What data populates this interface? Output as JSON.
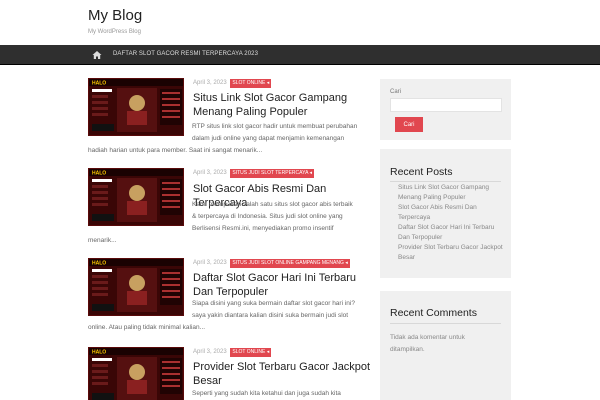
{
  "site": {
    "title": "My Blog",
    "description": "My WordPress Blog"
  },
  "nav": {
    "home_icon": "home-icon",
    "link": "DAFTAR SLOT GACOR RESMI TERPERCAYA 2023"
  },
  "thumbnail_logo": "HALO",
  "posts": [
    {
      "date": "April 3, 2023",
      "category": "SLOT ONLINE",
      "title": "Situs Link Slot Gacor Gampang Menang Paling Populer",
      "excerpt_1": "RTP situs link slot gacor hadir untuk membuat perubahan",
      "excerpt_2": "dalam judi online yang dapat menjamin kemenangan",
      "excerpt_3": "hadiah harian untuk para member. Saat ini sangat menarik..."
    },
    {
      "date": "April 3, 2023",
      "category": "SITUS JUDI SLOT TERPERCAYA",
      "title": "Slot Gacor Abis Resmi Dan Terpercaya",
      "excerpt_1": "Kami  merupakan salah satu situs slot gacor abis terbaik",
      "excerpt_2": "& terpercaya di Indonesia. Situs judi slot online yang",
      "excerpt_3": "Berlisensi Resmi.ini, menyediakan promo insentif",
      "excerpt_4": "menarik..."
    },
    {
      "date": "April 3, 2023",
      "category": "SITUS JUDI SLOT ONLINE GAMPANG MENANG",
      "title": "Daftar Slot Gacor Hari Ini Terbaru Dan Terpopuler",
      "excerpt_1": "Siapa disini yang suka bermain daftar slot gacor hari ini?",
      "excerpt_2": "saya yakin diantara kalian disini suka bermain judi slot",
      "excerpt_3": "online. Atau paling tidak minimal kalian..."
    },
    {
      "date": "April 3, 2023",
      "category": "SLOT ONLINE",
      "title": "Provider Slot Terbaru Gacor Jackpot Besar",
      "excerpt_1": "Seperti yang sudah kita ketahui dan juga sudah kita"
    }
  ],
  "sidebar": {
    "search": {
      "label": "Cari",
      "value": "",
      "button": "Cari"
    },
    "recent_posts": {
      "title": "Recent Posts",
      "items": [
        "Situs Link Slot Gacor Gampang Menang Paling Populer",
        "Slot Gacor Abis Resmi Dan Terpercaya",
        "Daftar Slot Gacor Hari Ini Terbaru Dan Terpopuler",
        "Provider Slot Terbaru Gacor Jackpot Besar"
      ]
    },
    "recent_comments": {
      "title": "Recent Comments",
      "text": "Tidak ada komentar untuk ditampilkan."
    }
  },
  "colors": {
    "accent": "#e1474f",
    "navbar": "#2f2f2f",
    "widget_bg": "#f0f0f0"
  }
}
